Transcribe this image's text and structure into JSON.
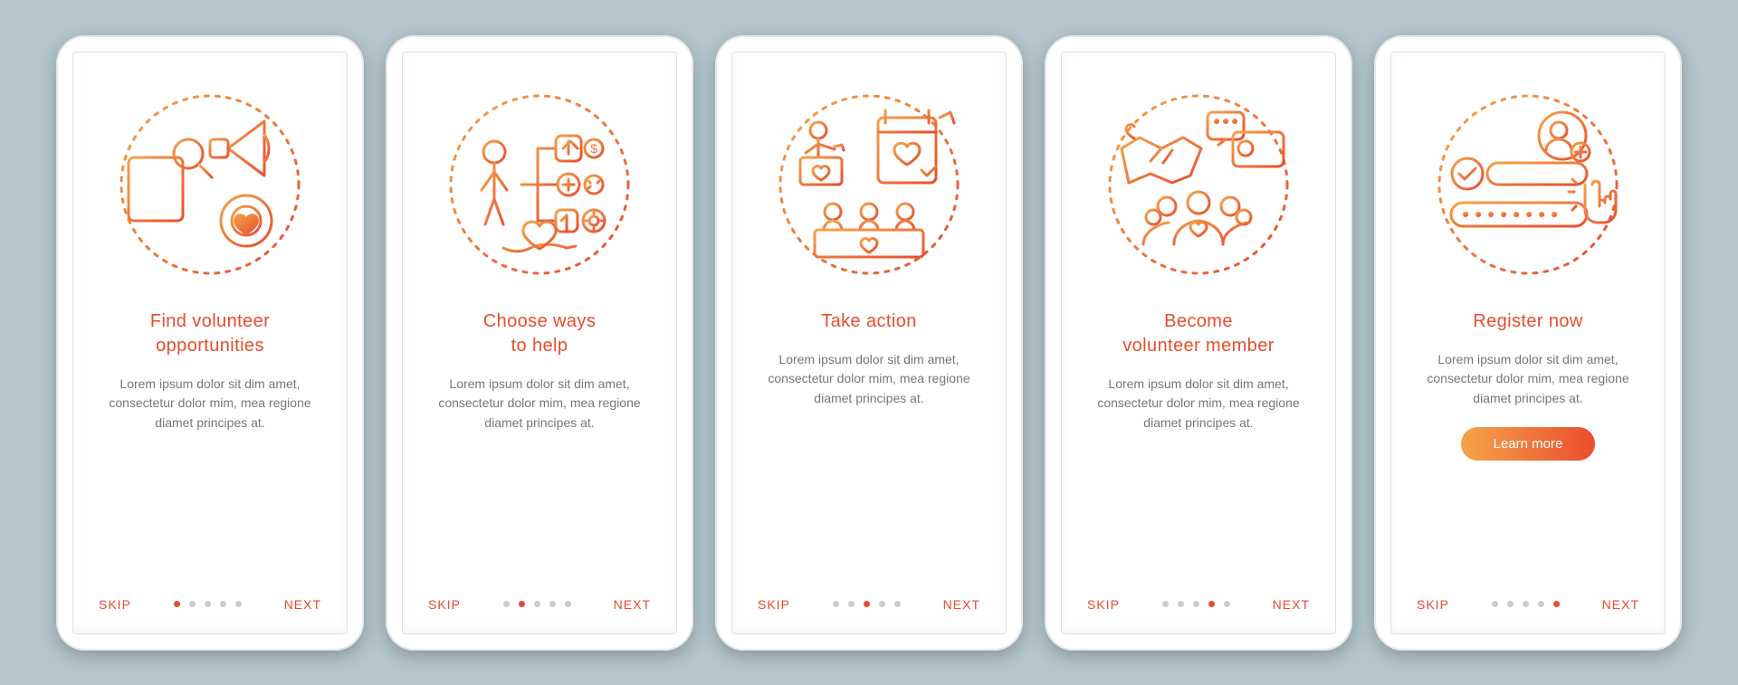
{
  "common": {
    "skip": "SKIP",
    "next": "NEXT",
    "body": "Lorem ipsum dolor sit dim amet, consectetur dolor mim, mea regione diamet principes at.",
    "total_dots": 5
  },
  "screens": [
    {
      "title": "Find volunteer\nopportunities",
      "active": 0,
      "cta": null
    },
    {
      "title": "Choose ways\nto help",
      "active": 1,
      "cta": null
    },
    {
      "title": "Take action",
      "active": 2,
      "cta": null
    },
    {
      "title": "Become\nvolunteer member",
      "active": 3,
      "cta": null
    },
    {
      "title": "Register now",
      "active": 4,
      "cta": "Learn more"
    }
  ],
  "colors": {
    "accent": "#E84C2D",
    "grad_a": "#F5A34A",
    "grad_b": "#E94E2E",
    "bg": "#b5c7cd"
  }
}
